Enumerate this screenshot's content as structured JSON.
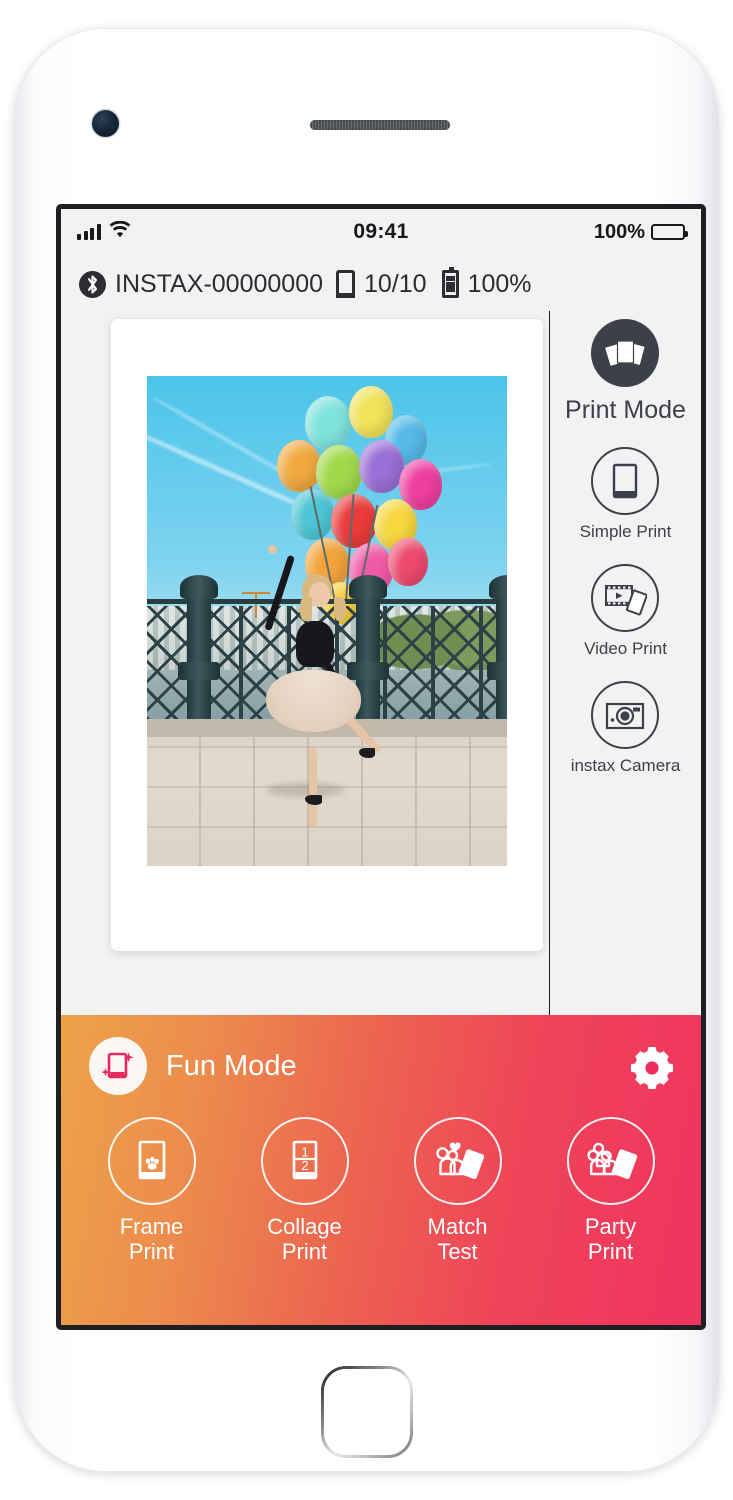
{
  "device": {
    "front_camera": "front-camera",
    "speaker": "earpiece-speaker",
    "home_button": "home-button"
  },
  "status_bar": {
    "signal_icon": "signal-bars-icon",
    "wifi_icon": "wifi-icon",
    "time": "09:41",
    "battery_percent": "100%",
    "battery_icon": "battery-icon"
  },
  "device_info": {
    "bluetooth_icon": "bluetooth-icon",
    "printer_name": "INSTAX-00000000",
    "film_icon": "film-cartridge-icon",
    "film_count": "10/10",
    "battery_icon": "battery-vertical-icon",
    "battery_level": "100%"
  },
  "preview": {
    "photo_alt": "woman-with-balloons-photo"
  },
  "sidebar": {
    "items": [
      {
        "label": "Print Mode",
        "icon": "stacked-photos-icon",
        "style": "filled"
      },
      {
        "label": "Simple Print",
        "icon": "single-photo-icon",
        "style": "outline"
      },
      {
        "label": "Video Print",
        "icon": "film-strip-play-icon",
        "style": "outline"
      },
      {
        "label": "instax Camera",
        "icon": "camera-icon",
        "style": "outline"
      }
    ]
  },
  "fun_mode": {
    "title": "Fun Mode",
    "icon": "sparkle-phone-icon",
    "settings_icon": "gear-icon",
    "actions": [
      {
        "label": "Frame\nPrint",
        "line1": "Frame",
        "line2": "Print",
        "icon": "paw-frame-icon"
      },
      {
        "label": "Collage\nPrint",
        "line1": "Collage",
        "line2": "Print",
        "icon": "collage-1-2-icon",
        "digit_top": "1",
        "digit_bottom": "2"
      },
      {
        "label": "Match\nTest",
        "line1": "Match",
        "line2": "Test",
        "icon": "two-people-heart-photo-icon"
      },
      {
        "label": "Party\nPrint",
        "line1": "Party",
        "line2": "Print",
        "icon": "three-people-photo-icon"
      }
    ]
  },
  "colors": {
    "screen_bg": "#f2f2f2",
    "icon_dark": "#3c4049",
    "fun_gradient_start": "#eda349",
    "fun_gradient_end": "#ef3360",
    "fun_icon_pink": "#e8295e",
    "bezel": "#1d1f22"
  }
}
